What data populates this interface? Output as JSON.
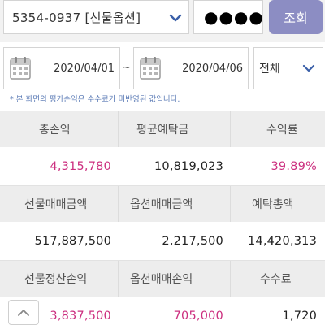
{
  "account": {
    "number": "5354-0937 [선물옵션]"
  },
  "password": {
    "masked": "●●●●"
  },
  "search_button": {
    "label": "조회"
  },
  "date_range": {
    "start": "2020/04/01",
    "separator": "~",
    "end": "2020/04/06"
  },
  "filter": {
    "selected": "전체"
  },
  "notice": "* 본 화면의 평가손익은 수수료가 미반영된 값입니다.",
  "summary": {
    "rows": [
      {
        "headers": [
          "총손익",
          "평균예탁금",
          "수익률"
        ],
        "values": [
          "4,315,780",
          "10,819,023",
          "39.89%"
        ],
        "highlight": [
          true,
          false,
          true
        ]
      },
      {
        "headers": [
          "선물매매금액",
          "옵션매매금액",
          "예탁총액"
        ],
        "values": [
          "517,887,500",
          "2,217,500",
          "14,420,313"
        ],
        "highlight": [
          false,
          false,
          false
        ]
      },
      {
        "headers": [
          "선물정산손익",
          "옵션매매손익",
          "수수료"
        ],
        "values": [
          "3,837,500",
          "705,000",
          "1,720"
        ],
        "highlight": [
          true,
          true,
          false
        ]
      }
    ]
  },
  "colors": {
    "accent": "#8c8dc3",
    "profit": "#cc2f7f",
    "notice": "#5a7ab5"
  },
  "icons": {
    "account_dropdown": "chevron-down-icon",
    "calendar": "calendar-icon",
    "scroll_top": "chevron-up-icon"
  }
}
